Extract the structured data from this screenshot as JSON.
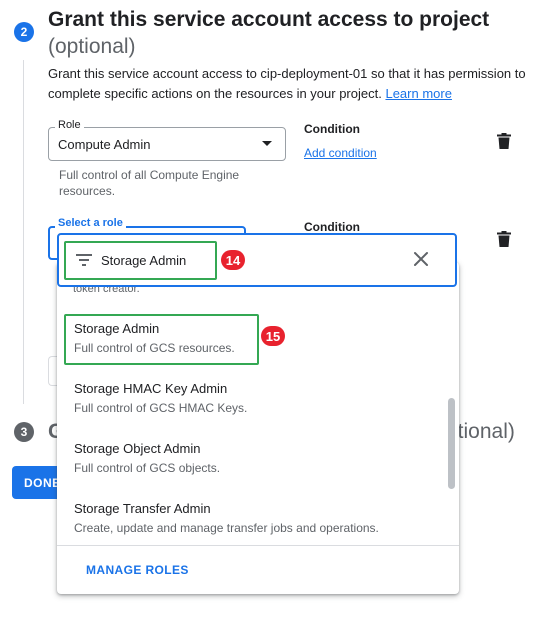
{
  "step2": {
    "number": "2",
    "title": "Grant this service account access to project",
    "optional": "(optional)",
    "description": "Grant this service account access to cip-deployment-01 so that it has permission to complete specific actions on the resources in your project.",
    "learn_more": "Learn more"
  },
  "role1": {
    "label": "Role",
    "value": "Compute Admin",
    "helper": "Full control of all Compute Engine resources.",
    "condition_label": "Condition",
    "add_condition": "Add condition"
  },
  "role2": {
    "label": "Select a role",
    "condition_label": "Condition"
  },
  "filter": {
    "value": "Storage Admin"
  },
  "badges": {
    "filter": "14",
    "option": "15"
  },
  "dropdown": {
    "cut_text": "token creator.",
    "options": [
      {
        "name": "Storage Admin",
        "desc": "Full control of GCS resources."
      },
      {
        "name": "Storage HMAC Key Admin",
        "desc": "Full control of GCS HMAC Keys."
      },
      {
        "name": "Storage Object Admin",
        "desc": "Full control of GCS objects."
      },
      {
        "name": "Storage Transfer Admin",
        "desc": "Create, update and manage transfer jobs and operations."
      }
    ],
    "manage_roles": "MANAGE ROLES"
  },
  "step3": {
    "number": "3",
    "title_partial": "G",
    "optional_partial": "ptional)"
  },
  "done_button": "DONE",
  "colors": {
    "accent": "#1a73e8",
    "highlight": "#34a853",
    "badge": "#e8222e"
  }
}
